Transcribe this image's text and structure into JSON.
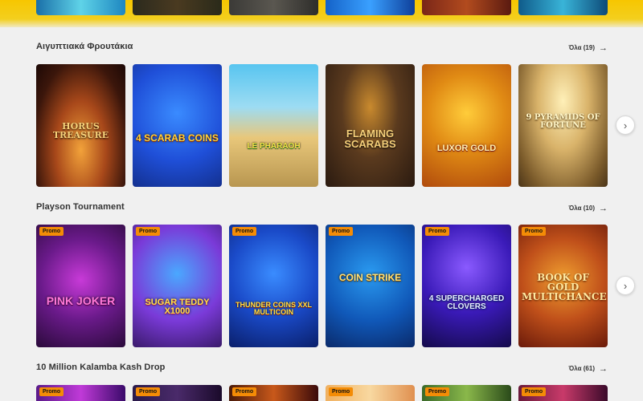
{
  "sections": [
    {
      "title": "Αιγυπτιακά Φρουτάκια",
      "see_all": "Όλα (19)",
      "games": [
        {
          "title": "Horus Treasure",
          "promo": ""
        },
        {
          "title": "4 Scarab Coins",
          "promo": ""
        },
        {
          "title": "Le Pharaoh",
          "promo": ""
        },
        {
          "title": "Flaming Scarabs",
          "promo": ""
        },
        {
          "title": "Luxor Gold",
          "promo": ""
        },
        {
          "title": "9 Pyramids of Fortune",
          "promo": ""
        }
      ]
    },
    {
      "title": "Playson Tournament",
      "see_all": "Όλα (10)",
      "games": [
        {
          "title": "Pink Joker",
          "promo": "Promo"
        },
        {
          "title": "Sugar Teddy x1000",
          "promo": "Promo"
        },
        {
          "title": "Thunder Coins XXL Multicoin",
          "promo": "Promo"
        },
        {
          "title": "Coin Strike",
          "promo": "Promo"
        },
        {
          "title": "4 Supercharged Clovers",
          "promo": "Promo"
        },
        {
          "title": "Book of Gold Multichance",
          "promo": "Promo"
        }
      ]
    },
    {
      "title": "10 Million Kalamba Kash Drop",
      "see_all": "Όλα (61)",
      "games": [
        {
          "promo": "Promo"
        },
        {
          "promo": "Promo"
        },
        {
          "promo": "Promo"
        },
        {
          "promo": "Promo"
        },
        {
          "promo": "Promo"
        },
        {
          "promo": "Promo"
        }
      ]
    }
  ],
  "icons": {
    "arrow": "→",
    "chevron": "›"
  }
}
